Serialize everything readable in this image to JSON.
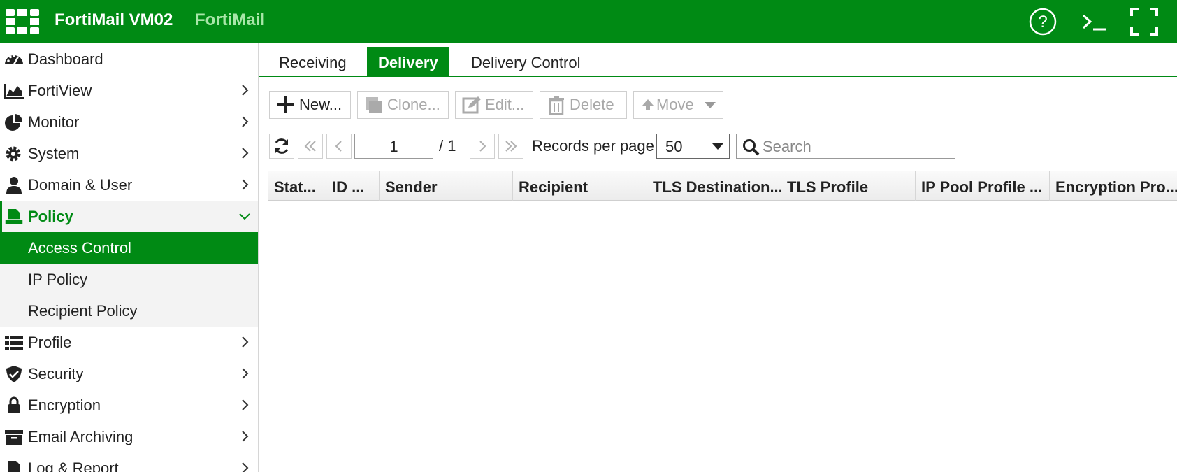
{
  "header": {
    "title": "FortiMail VM02",
    "subtitle": "FortiMail",
    "icons": [
      "fortinet-logo-icon",
      "help-icon",
      "cli-console-icon",
      "fullscreen-icon"
    ],
    "brand_color": "#008a14"
  },
  "sidebar": {
    "items": [
      {
        "label": "Dashboard",
        "icon": "dashboard-icon",
        "has_children": false
      },
      {
        "label": "FortiView",
        "icon": "chart-area-icon",
        "has_children": true
      },
      {
        "label": "Monitor",
        "icon": "pie-chart-icon",
        "has_children": true
      },
      {
        "label": "System",
        "icon": "gear-icon",
        "has_children": true
      },
      {
        "label": "Domain & User",
        "icon": "user-icon",
        "has_children": true
      },
      {
        "label": "Policy",
        "icon": "policy-icon",
        "has_children": true,
        "expanded": true,
        "children": [
          {
            "label": "Access Control",
            "selected": true
          },
          {
            "label": "IP Policy",
            "selected": false
          },
          {
            "label": "Recipient Policy",
            "selected": false
          }
        ]
      },
      {
        "label": "Profile",
        "icon": "list-icon",
        "has_children": true
      },
      {
        "label": "Security",
        "icon": "shield-icon",
        "has_children": true
      },
      {
        "label": "Encryption",
        "icon": "lock-icon",
        "has_children": true
      },
      {
        "label": "Email Archiving",
        "icon": "archive-icon",
        "has_children": true
      },
      {
        "label": "Log & Report",
        "icon": "report-icon",
        "has_children": true
      }
    ]
  },
  "tabs": [
    {
      "label": "Receiving",
      "active": false
    },
    {
      "label": "Delivery",
      "active": true
    },
    {
      "label": "Delivery Control",
      "active": false
    }
  ],
  "toolbar": {
    "new_label": "New...",
    "clone_label": "Clone...",
    "edit_label": "Edit...",
    "delete_label": "Delete",
    "move_label": "Move"
  },
  "pager": {
    "current_page": "1",
    "total_pages": "/ 1",
    "records_label": "Records per page",
    "records_per_page": "50",
    "search_placeholder": "Search"
  },
  "table": {
    "columns": [
      "Stat...",
      "ID ...",
      "Sender",
      "Recipient",
      "TLS Destination...",
      "TLS Profile",
      "IP Pool Profile ...",
      "Encryption Pro..."
    ],
    "rows": []
  }
}
